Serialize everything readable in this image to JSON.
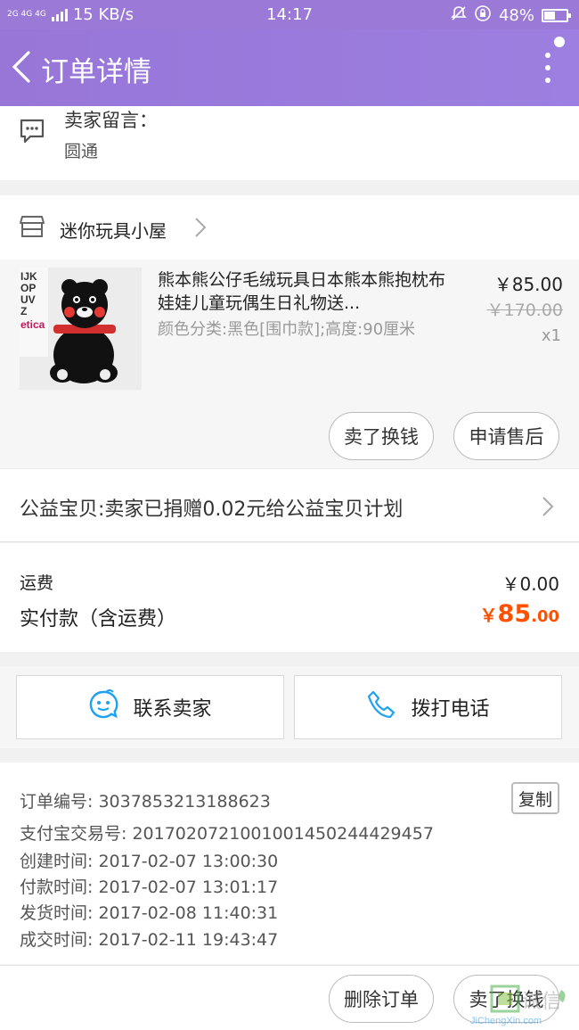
{
  "status_bar": {
    "network": "2G 4G 4G",
    "speed": "15 KB/s",
    "time": "14:17",
    "battery": "48%",
    "battery_level": 0.48
  },
  "header": {
    "title": "订单详情"
  },
  "message": {
    "label": "卖家留言：",
    "value": "圆通"
  },
  "shop": {
    "name": "迷你玩具小屋"
  },
  "item": {
    "title": "熊本熊公仔毛绒玩具日本熊本熊抱枕布娃娃儿童玩偶生日礼物送...",
    "sku": "颜色分类:黑色[围巾款];高度:90厘米",
    "price": "￥85.00",
    "original_price": "￥170.00",
    "quantity": "x1",
    "thumb_text": "IJK\nOP\nUV\nZ\netica",
    "btn_resell": "卖了换钱",
    "btn_aftersale": "申请售后"
  },
  "charity": {
    "text": "公益宝贝:卖家已捐赠0.02元给公益宝贝计划"
  },
  "fees": {
    "shipping_label": "运费",
    "shipping_value": "￥0.00",
    "paid_label": "实付款（含运费）",
    "paid_currency": "￥",
    "paid_int": "85",
    "paid_dec": ".00"
  },
  "contact": {
    "seller": "联系卖家",
    "call": "拨打电话"
  },
  "order_info": {
    "order_no": "订单编号: 3037853213188623",
    "copy": "复制",
    "alipay_no": "支付宝交易号: 2017020721001001450244429457",
    "created": "创建时间: 2017-02-07 13:00:30",
    "paid": "付款时间: 2017-02-07 13:01:17",
    "shipped": "发货时间: 2017-02-08 11:40:31",
    "completed": "成交时间: 2017-02-11 19:43:47"
  },
  "footer": {
    "delete": "删除订单",
    "resell": "卖了换钱"
  },
  "watermark": {
    "cn": "诚信",
    "url": "JiChengXin.com"
  },
  "colors": {
    "accent": "#9b79d6",
    "price": "#ff5000",
    "icon_blue": "#1da1f2"
  }
}
